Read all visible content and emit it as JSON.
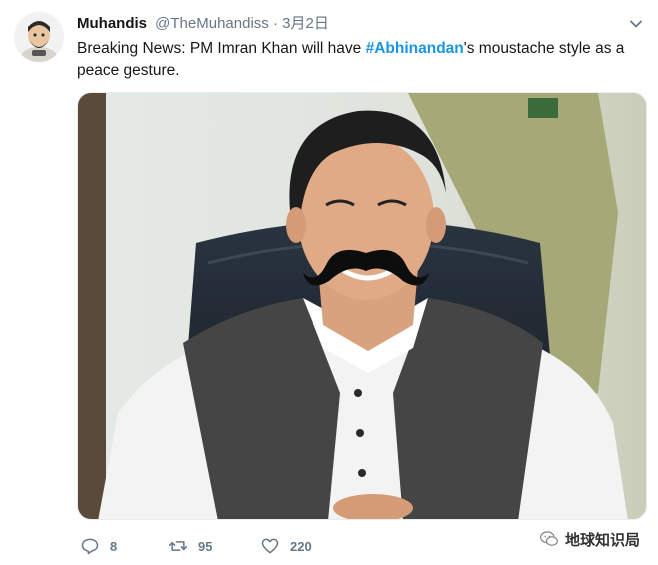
{
  "tweet": {
    "display_name": "Muhandis",
    "handle": "@TheMuhandiss",
    "separator": "·",
    "date": "3月2日",
    "text_before": "Breaking News: PM Imran Khan will have ",
    "hashtag": "#Abhinandan",
    "text_after": "'s moustache style as a peace gesture."
  },
  "icons": {
    "avatar": "avatar-cartoon",
    "caret": "chevron-down-icon",
    "reply": "reply-icon",
    "retweet": "retweet-icon",
    "like": "heart-icon",
    "watermark": "wechat-icon"
  },
  "actions": {
    "reply_count": "8",
    "retweet_count": "95",
    "like_count": "220"
  },
  "watermark": {
    "text": "地球知识局"
  },
  "colors": {
    "link": "#1b95e0",
    "secondary": "#657786"
  }
}
